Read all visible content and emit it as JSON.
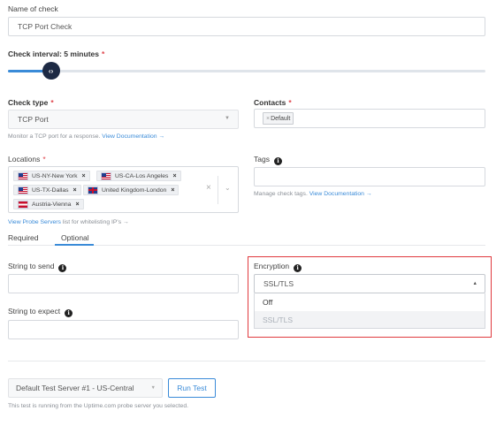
{
  "name_label": "Name of check",
  "name_value": "TCP Port Check",
  "interval_label": "Check interval: 5 minutes",
  "interval_required": "*",
  "interval_slider_fraction": 0.09,
  "check_type": {
    "label": "Check type",
    "required": "*",
    "value": "TCP Port",
    "help": "Monitor a TCP port for a response.",
    "help_link": "View Documentation →"
  },
  "contacts": {
    "label": "Contacts",
    "required": "*",
    "tag_x": "×",
    "tag": "Default"
  },
  "locations": {
    "label": "Locations",
    "required": "*",
    "remove": "×",
    "items": [
      {
        "label": "US-NY-New York",
        "flag": "us-flag"
      },
      {
        "label": "US-CA-Los Angeles",
        "flag": "us-flag"
      },
      {
        "label": "US-TX-Dallas",
        "flag": "us-flag"
      },
      {
        "label": "United Kingdom-London",
        "flag": "uk-flag"
      },
      {
        "label": "Austria-Vienna",
        "flag": "austria-flag"
      }
    ],
    "clear": "×",
    "help_link": "View Probe Servers",
    "help": "list for whitelisting IP's →"
  },
  "tags": {
    "label": "Tags",
    "help": "Manage check tags.",
    "help_link": "View Documentation →"
  },
  "tabs": [
    {
      "label": "Required",
      "active": false
    },
    {
      "label": "Optional",
      "active": true
    }
  ],
  "string_to_send": {
    "label": "String to send",
    "value": ""
  },
  "string_to_expect": {
    "label": "String to expect",
    "value": ""
  },
  "encryption": {
    "label": "Encryption",
    "selected": "SSL/TLS",
    "options": [
      "Off",
      "SSL/TLS"
    ],
    "highlight_color": "#e03a3e"
  },
  "test": {
    "server_select": "Default Test Server #1 - US-Central",
    "run_button": "Run Test",
    "help": "This test is running from the Uptime.com probe server you selected."
  },
  "colors": {
    "accent": "#3a8bd8",
    "slider_handle": "#1d2a44",
    "required": "#e0464d"
  }
}
